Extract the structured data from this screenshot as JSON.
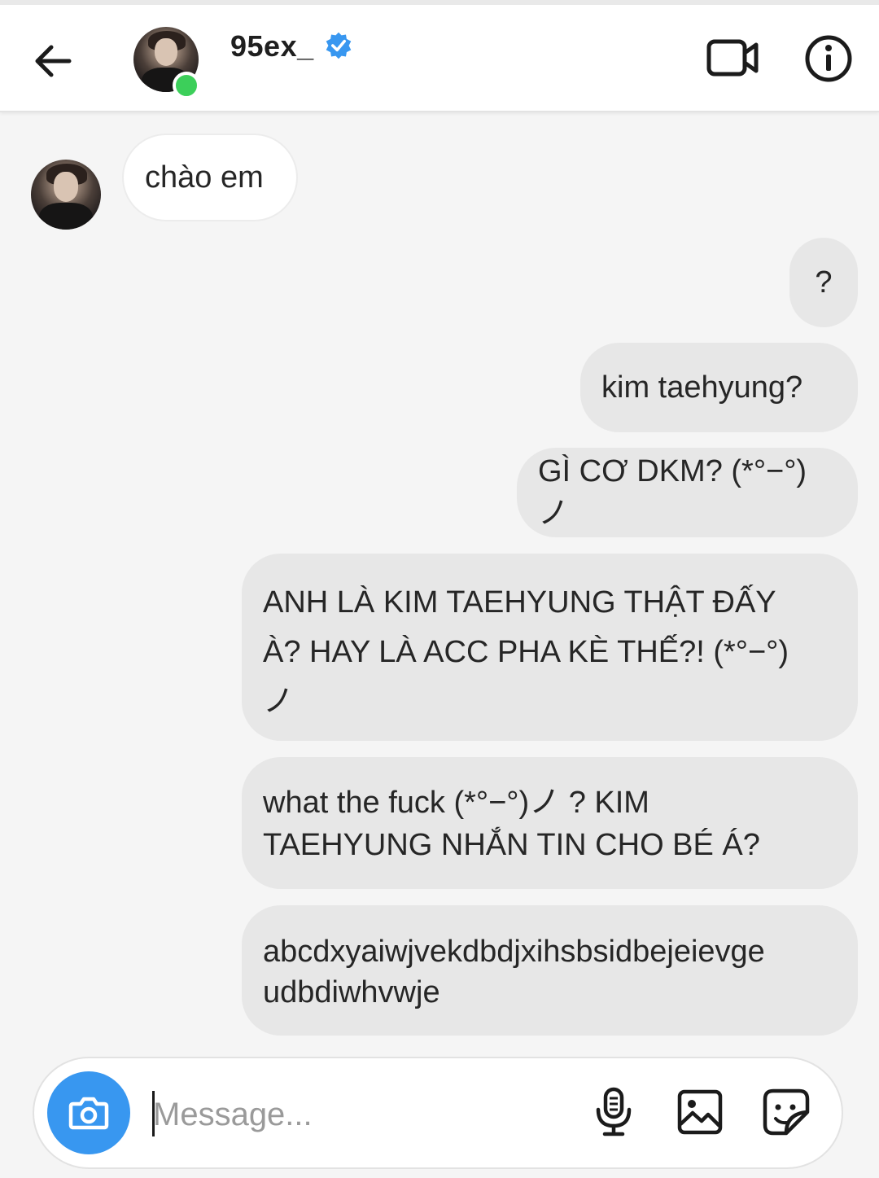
{
  "header": {
    "back_icon": "arrow-left-icon",
    "username": "95ex_",
    "verified_icon": "verified-badge-icon",
    "status_color": "#3ccf5a",
    "video_icon": "video-camera-icon",
    "info_icon": "info-icon"
  },
  "messages": [
    {
      "from": "them",
      "text": "chào em"
    },
    {
      "from": "me",
      "text": "?"
    },
    {
      "from": "me",
      "text": "kim taehyung?"
    },
    {
      "from": "me",
      "text": "GÌ CƠ DKM? (*°−°)ノ"
    },
    {
      "from": "me",
      "line1": "ANH LÀ KIM TAEHYUNG THẬT ĐẤY",
      "line2": "À? HAY LÀ ACC PHA KÈ THẾ?! (*°−°)",
      "line3": "ノ"
    },
    {
      "from": "me",
      "line1": "what the fuck (*°−°)ノ ? KIM",
      "line2": "TAEHYUNG NHẮN TIN CHO BÉ Á?"
    },
    {
      "from": "me",
      "line1": "abcdxyaiwjvekdbdjxihsbsidbejeievge",
      "line2": "udbdiwhvwje"
    }
  ],
  "composer": {
    "placeholder": "Message...",
    "camera_icon": "camera-icon",
    "mic_icon": "microphone-icon",
    "gallery_icon": "image-gallery-icon",
    "sticker_icon": "sticker-icon",
    "accent_color": "#3897f0"
  }
}
